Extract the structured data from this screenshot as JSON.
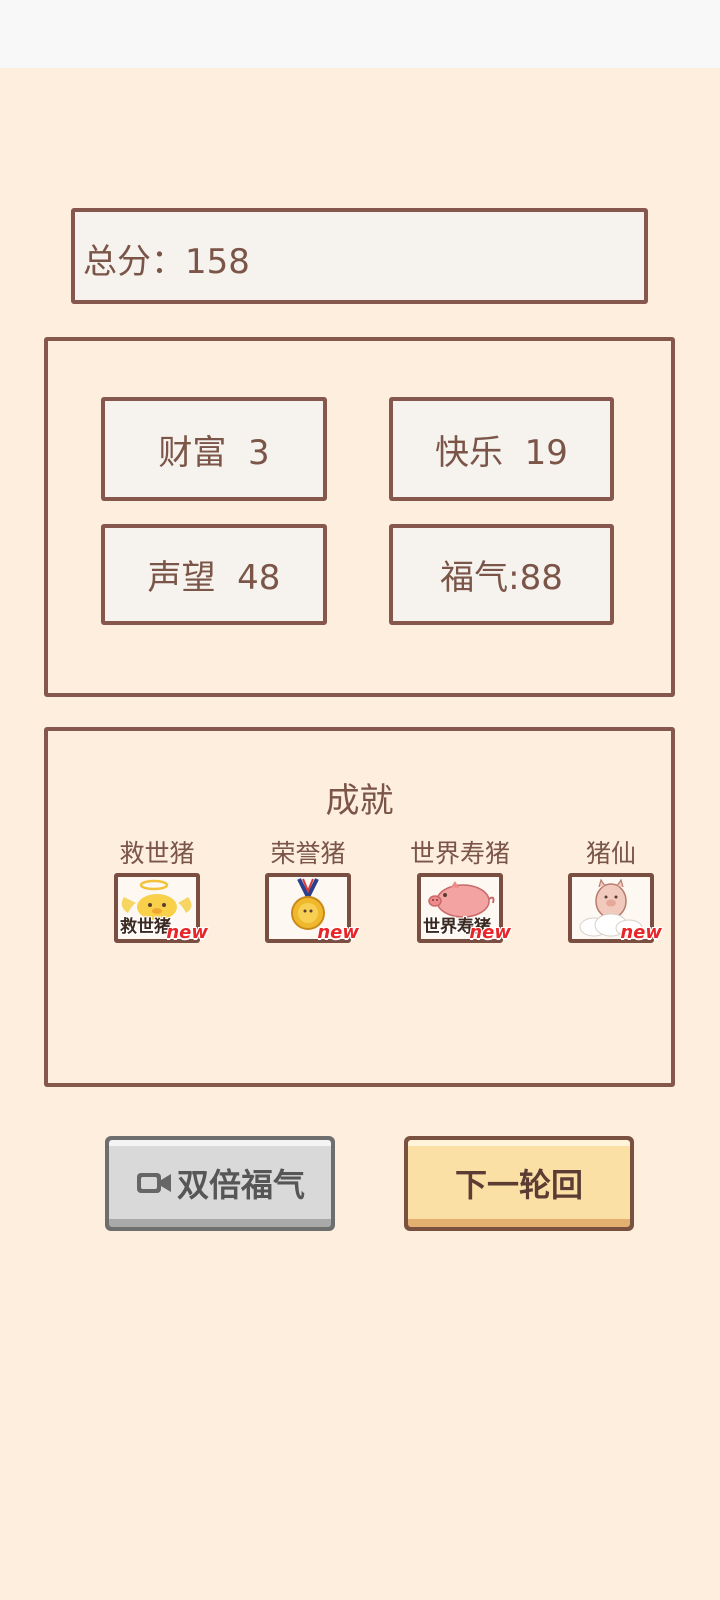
{
  "total": {
    "text": "总分：158"
  },
  "stats": {
    "wealth": "财富  3",
    "happiness": "快乐  19",
    "prestige": "声望  48",
    "fortune": "福气:88"
  },
  "achievements": {
    "title": "成就",
    "items": [
      {
        "label": "救世猪",
        "icon": "angel-pig-icon",
        "caption": "救世猪",
        "badge": "new"
      },
      {
        "label": "荣誉猪",
        "icon": "medal-icon",
        "caption": "",
        "badge": "new"
      },
      {
        "label": "世界寿猪",
        "icon": "pink-pig-icon",
        "caption": "世界寿猪",
        "badge": "new"
      },
      {
        "label": "猪仙",
        "icon": "cloud-pig-icon",
        "caption": "",
        "badge": "new"
      }
    ]
  },
  "buttons": {
    "double_fortune": "双倍福气",
    "next_round": "下一轮回"
  },
  "colors": {
    "background": "#fdeedd",
    "border": "#86584d",
    "new_badge": "#e8262a",
    "next_button": "#fbe0a5"
  }
}
